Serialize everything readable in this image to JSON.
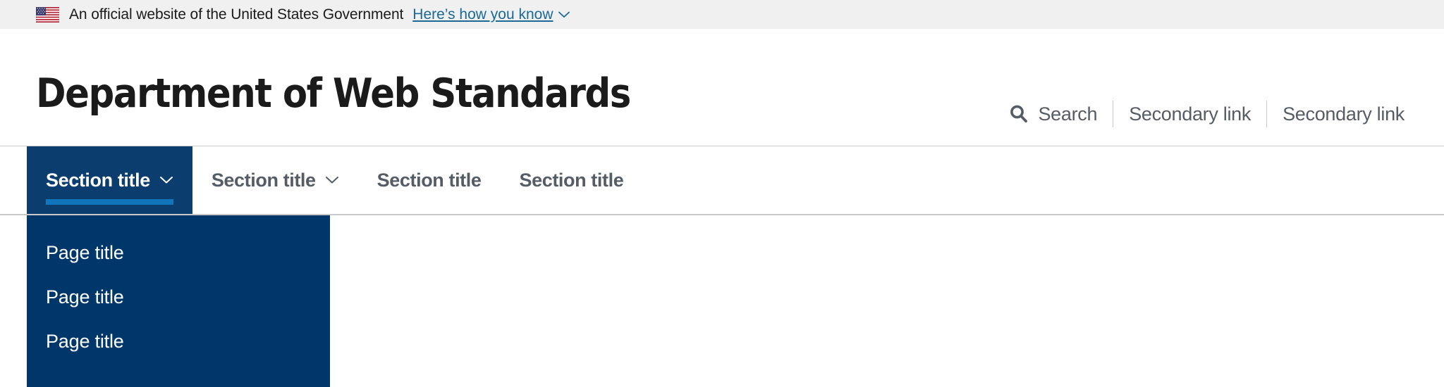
{
  "gov_banner": {
    "flag_icon": "us-flag-icon",
    "text": "An official website of the United States Government",
    "link_label": "Here’s how you know",
    "chevron_icon": "chevron-down-icon",
    "background_color": "#f0f0f0",
    "link_color": "#1a6a94"
  },
  "masthead": {
    "site_title": "Department of Web Standards",
    "title_color": "#1b1b1b",
    "secondary_nav": {
      "search": {
        "icon": "search-icon",
        "label": "Search"
      },
      "links": [
        {
          "label": "Secondary link"
        },
        {
          "label": "Secondary link"
        }
      ],
      "text_color": "#565c65",
      "divider_color": "#c9c9c9"
    }
  },
  "primary_nav": {
    "items": [
      {
        "label": "Section title",
        "has_chevron": true,
        "active": true
      },
      {
        "label": "Section title",
        "has_chevron": true,
        "active": false
      },
      {
        "label": "Section title",
        "has_chevron": false,
        "active": false
      },
      {
        "label": "Section title",
        "has_chevron": false,
        "active": false
      }
    ],
    "active_background": "#0b3d6e",
    "active_underline_color": "#1075ba",
    "inactive_text_color": "#565c65",
    "border_color": "#c9c9c9"
  },
  "dropdown": {
    "open": true,
    "background_color": "#00376b",
    "items": [
      {
        "label": "Page title"
      },
      {
        "label": "Page title"
      },
      {
        "label": "Page title"
      }
    ]
  }
}
